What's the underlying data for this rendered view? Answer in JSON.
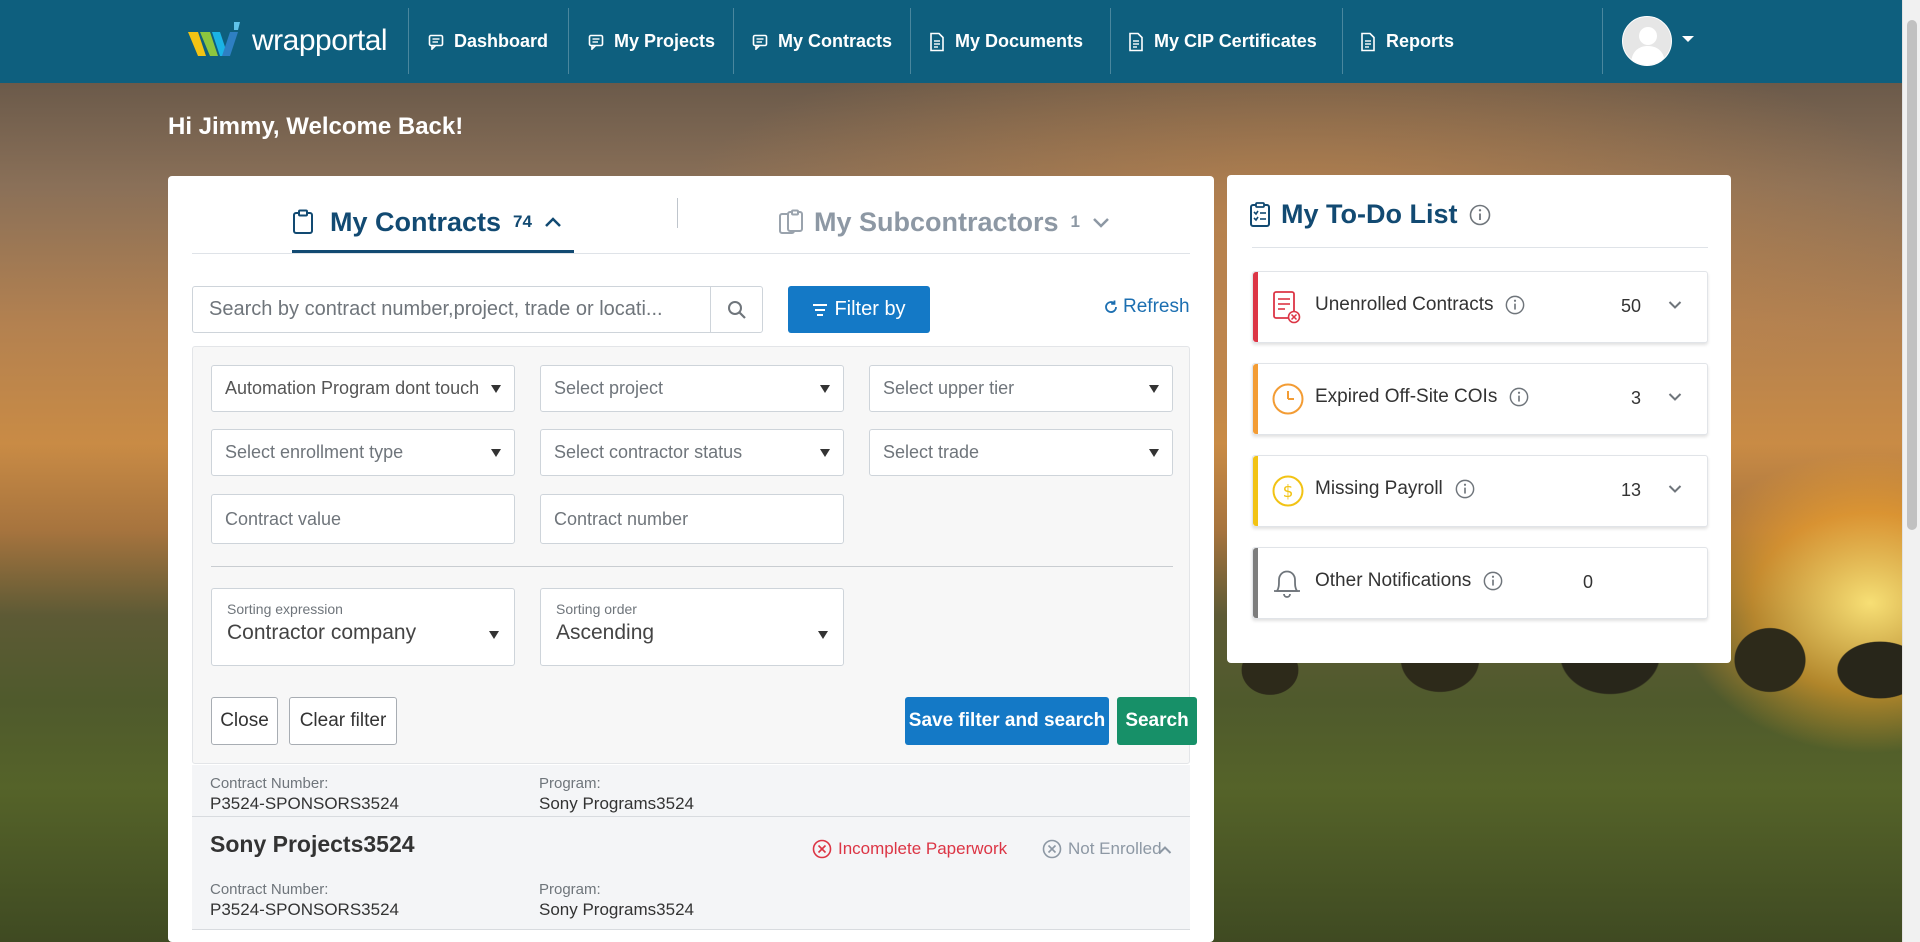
{
  "nav": {
    "logo_text_bold": "wrap",
    "logo_text_light": "portal",
    "items": [
      {
        "label": "Dashboard",
        "icon": "comment-icon"
      },
      {
        "label": "My Projects",
        "icon": "comment-icon"
      },
      {
        "label": "My Contracts",
        "icon": "comment-icon"
      },
      {
        "label": "My Documents",
        "icon": "document-icon"
      },
      {
        "label": "My CIP Certificates",
        "icon": "document-icon"
      },
      {
        "label": "Reports",
        "icon": "document-icon"
      }
    ]
  },
  "welcome": "Hi Jimmy, Welcome Back!",
  "contracts_card": {
    "tabs": [
      {
        "label": "My Contracts",
        "count": "74"
      },
      {
        "label": "My Subcontractors",
        "count": "1"
      }
    ],
    "search_placeholder": "Search by contract number,project, trade or locati...",
    "filter_label": "Filter by",
    "refresh_label": "Refresh",
    "filters": {
      "program": "Automation Program dont touch",
      "project": "Select project",
      "upper_tier": "Select upper tier",
      "enrollment_type": "Select enrollment type",
      "contractor_status": "Select contractor status",
      "trade": "Select trade",
      "contract_value": "Contract value",
      "contract_number": "Contract number",
      "sorting_expression_label": "Sorting expression",
      "sorting_expression_value": "Contractor company",
      "sorting_order_label": "Sorting order",
      "sorting_order_value": "Ascending"
    },
    "buttons": {
      "close": "Close",
      "clear": "Clear filter",
      "save": "Save filter and search",
      "search": "Search"
    },
    "rows": [
      {
        "contract_number_label": "Contract Number:",
        "contract_number": "P3524-SPONSORS3524",
        "program_label": "Program:",
        "program": "Sony Programs3524"
      },
      {
        "title": "Sony Projects3524",
        "status_incomplete": "Incomplete Paperwork",
        "status_enrolled": "Not Enrolled",
        "contract_number_label": "Contract Number:",
        "contract_number": "P3524-SPONSORS3524",
        "program_label": "Program:",
        "program": "Sony Programs3524"
      }
    ]
  },
  "todo": {
    "title": "My To-Do List",
    "items": [
      {
        "label": "Unenrolled Contracts",
        "count": "50",
        "color": "#dc3545",
        "icon": "unenrolled-contract-icon"
      },
      {
        "label": "Expired Off-Site COIs",
        "count": "3",
        "color": "#f39c34",
        "icon": "clock-icon"
      },
      {
        "label": "Missing Payroll",
        "count": "13",
        "color": "#f2c314",
        "icon": "dollar-icon"
      },
      {
        "label": "Other Notifications",
        "count": "0",
        "color": "#7d7d7d",
        "icon": "bell-icon"
      }
    ]
  },
  "colors": {
    "nav_bg": "#0e5f7e",
    "primary_blue": "#1479c6",
    "success_green": "#179068",
    "heading_navy": "#124a72"
  }
}
